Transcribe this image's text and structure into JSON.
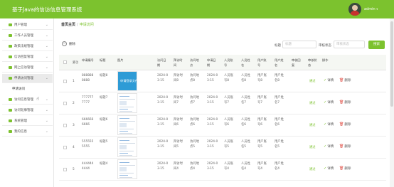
{
  "app": {
    "title": "基于Java的信访信息管理系统",
    "user": "admin",
    "caret": "▾"
  },
  "sidebar": {
    "items": [
      {
        "label": "用户管理"
      },
      {
        "label": "工作人员管理"
      },
      {
        "label": "政策法规管理"
      },
      {
        "label": "信访回复管理"
      },
      {
        "label": "网上信访管理"
      },
      {
        "label": "申请访问管理",
        "active": true,
        "sub": [
          {
            "label": "申请访问"
          }
        ]
      },
      {
        "label": "访问信息管理"
      },
      {
        "label": "访问轮廓管理"
      },
      {
        "label": "系统管理"
      },
      {
        "label": "我的信息"
      }
    ]
  },
  "breadcrumb": {
    "home": "首页主页",
    "sep": "/",
    "current": "申请访问"
  },
  "toolbar": {
    "delete_label": "删除",
    "filter1_label": "标题",
    "filter1_placeholder": "标题",
    "filter2_label": "审核状态",
    "filter2_placeholder": "审核状态",
    "search_label": "搜索"
  },
  "table": {
    "headers": [
      "索引",
      "申请编号",
      "标题",
      "图片",
      "访问日期",
      "拜访时间",
      "访问地点",
      "申请日期",
      "人员账号",
      "人员姓名",
      "用户账号",
      "用户姓名",
      "审核回复",
      "审核状态",
      "操作"
    ],
    "rows": [
      {
        "index": "1",
        "number": "8888888888",
        "title": "标题8",
        "image": "blue",
        "image_text": "申请登录文件",
        "visit_date": "2024-03-15",
        "time": "拜访时间8",
        "place": "访问地点8",
        "apply_date": "2024-03-15",
        "staff_acc": "人员账号8",
        "staff_name": "人员姓名8",
        "user_acc": "用户账号8",
        "user_name": "用户姓名8",
        "reply": "",
        "status": "通过"
      },
      {
        "index": "2",
        "number": "7777777777",
        "title": "标题7",
        "image": "doc",
        "image_text": "",
        "visit_date": "2024-03-15",
        "time": "拜访时间7",
        "place": "访问地点7",
        "apply_date": "2024-03-15",
        "staff_acc": "人员账号7",
        "staff_name": "人员姓名7",
        "user_acc": "用户账号7",
        "user_name": "用户姓名7",
        "reply": "",
        "status": "通过"
      },
      {
        "index": "3",
        "number": "6666666666",
        "title": "标题6",
        "image": "doc",
        "image_text": "",
        "visit_date": "2024-03-15",
        "time": "拜访时间6",
        "place": "访问地点6",
        "apply_date": "2024-03-15",
        "staff_acc": "人员账号6",
        "staff_name": "人员姓名6",
        "user_acc": "用户账号6",
        "user_name": "用户姓名6",
        "reply": "",
        "status": "通过"
      },
      {
        "index": "4",
        "number": "5555555555",
        "title": "标题5",
        "image": "doc",
        "image_text": "",
        "visit_date": "2024-03-15",
        "time": "拜访时间5",
        "place": "访问地点5",
        "apply_date": "2024-03-15",
        "staff_acc": "人员账号5",
        "staff_name": "人员姓名5",
        "user_acc": "用户账号5",
        "user_name": "用户姓名5",
        "reply": "",
        "status": "通过"
      },
      {
        "index": "5",
        "number": "4444444444",
        "title": "标题4",
        "image": "doc",
        "image_text": "",
        "visit_date": "2024-03-15",
        "time": "拜访时间4",
        "place": "访问地点4",
        "apply_date": "2024-03-15",
        "staff_acc": "人员账号4",
        "staff_name": "人员姓名4",
        "user_acc": "用户账号4",
        "user_name": "用户姓名4",
        "reply": "",
        "status": "通过"
      }
    ],
    "view_label": "详情",
    "delete_label": "删除"
  },
  "colors": {
    "accent": "#7cc22e",
    "danger": "#e0534a"
  },
  "icons": {
    "delete": "minus-circle-icon",
    "view": "check-circle-icon",
    "row_delete": "trash-icon",
    "menu": "green-square-icon",
    "chevron": "chevron-down-icon"
  }
}
